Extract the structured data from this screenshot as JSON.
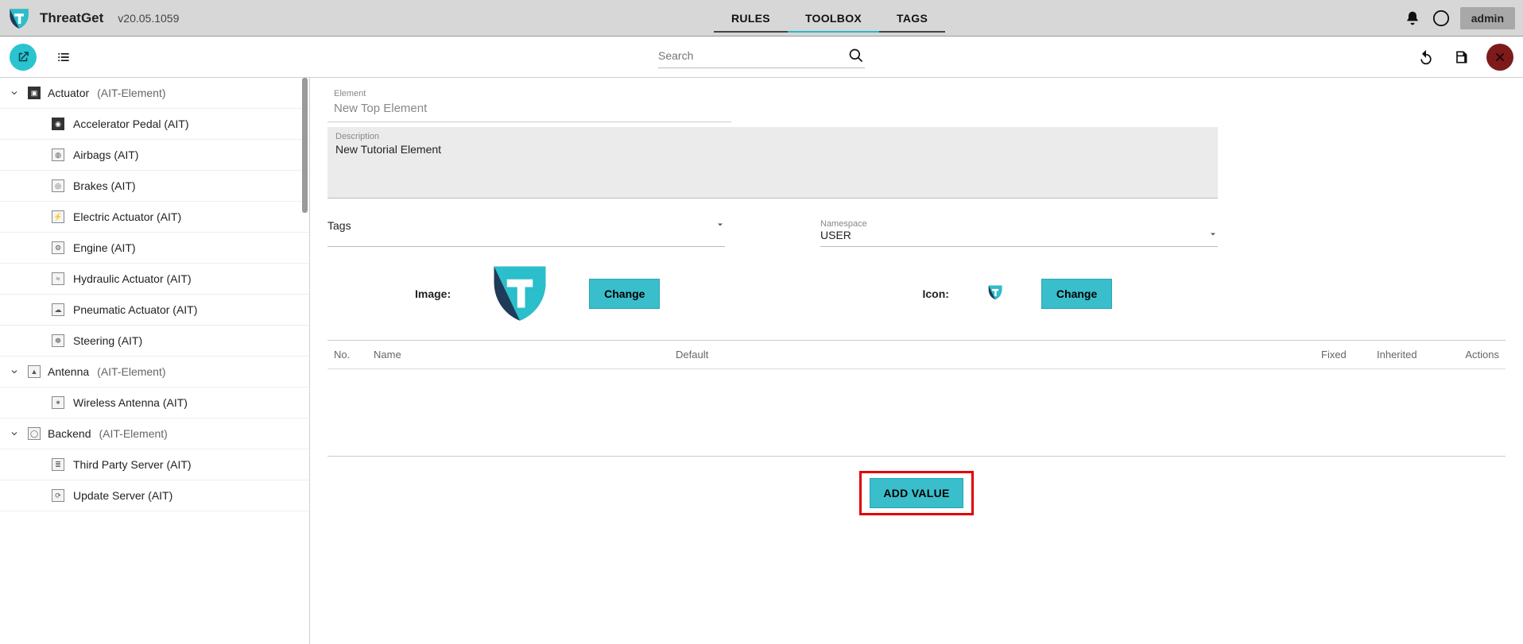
{
  "header": {
    "app_name": "ThreatGet",
    "version": "v20.05.1059",
    "tabs": [
      {
        "label": "RULES",
        "active": false
      },
      {
        "label": "TOOLBOX",
        "active": true
      },
      {
        "label": "TAGS",
        "active": false
      }
    ],
    "user_label": "admin"
  },
  "toolbar": {
    "search_placeholder": "Search"
  },
  "sidebar": {
    "groups": [
      {
        "name": "Actuator",
        "type": "(AIT-Element)",
        "expanded": true,
        "children": [
          {
            "label": "Accelerator Pedal (AIT)"
          },
          {
            "label": "Airbags (AIT)"
          },
          {
            "label": "Brakes (AIT)"
          },
          {
            "label": "Electric Actuator (AIT)"
          },
          {
            "label": "Engine (AIT)"
          },
          {
            "label": "Hydraulic Actuator (AIT)"
          },
          {
            "label": "Pneumatic Actuator (AIT)"
          },
          {
            "label": "Steering (AIT)"
          }
        ]
      },
      {
        "name": "Antenna",
        "type": "(AIT-Element)",
        "expanded": true,
        "children": [
          {
            "label": "Wireless Antenna (AIT)"
          }
        ]
      },
      {
        "name": "Backend",
        "type": "(AIT-Element)",
        "expanded": true,
        "children": [
          {
            "label": "Third Party Server (AIT)"
          },
          {
            "label": "Update Server (AIT)"
          }
        ]
      }
    ]
  },
  "form": {
    "element_label": "Element",
    "element_value": "New Top Element",
    "description_label": "Description",
    "description_value": "New Tutorial Element",
    "tags_label": "Tags",
    "tags_value": "",
    "namespace_label": "Namespace",
    "namespace_value": "USER",
    "image_label": "Image:",
    "icon_label": "Icon:",
    "change_label": "Change",
    "columns": {
      "no": "No.",
      "name": "Name",
      "default": "Default",
      "fixed": "Fixed",
      "inherited": "Inherited",
      "actions": "Actions"
    },
    "add_value_label": "ADD VALUE"
  }
}
